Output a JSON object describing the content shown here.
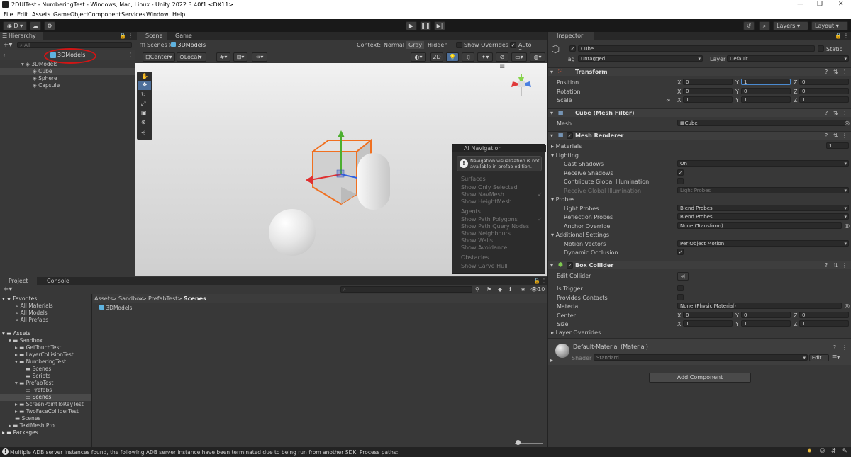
{
  "window": {
    "title": "2DUITest - NumberingTest - Windows, Mac, Linux - Unity 2022.3.40f1 <DX11>",
    "controls": [
      "—",
      "❐",
      "✕"
    ]
  },
  "menu": [
    "File",
    "Edit",
    "Assets",
    "GameObject",
    "Component",
    "Services",
    "Window",
    "Help"
  ],
  "toolbar": {
    "account": "D",
    "layers": "Layers",
    "layout": "Layout"
  },
  "hierarchy": {
    "tab": "Hierarchy",
    "search_placeholder": "All",
    "breadcrumb": "3DModels",
    "root": "3DModels",
    "items": [
      "Cube",
      "Sphere",
      "Capsule"
    ]
  },
  "scene": {
    "tabs": [
      "Scene",
      "Game"
    ],
    "breadcrumb_root": "Scenes",
    "breadcrumb_leaf": "3DModels",
    "context_label": "Context:",
    "context_options": [
      "Normal",
      "Gray",
      "Hidden"
    ],
    "show_overrides": "Show Overrides",
    "auto_save": "Auto Save",
    "pivot": "Center",
    "space": "Local",
    "mode2d": "2D"
  },
  "ai_nav": {
    "title": "AI Navigation",
    "notice": "Navigation visualization is not available in prefab edition.",
    "surfaces": "Surfaces",
    "surface_items": [
      "Show Only Selected",
      "Show NavMesh",
      "Show HeightMesh"
    ],
    "agents": "Agents",
    "agent_items": [
      "Show Path Polygons",
      "Show Path Query Nodes",
      "Show Neighbours",
      "Show Walls",
      "Show Avoidance"
    ],
    "obstacles": "Obstacles",
    "obstacle_items": [
      "Show Carve Hull"
    ]
  },
  "project": {
    "tabs": [
      "Project",
      "Console"
    ],
    "favorites": "Favorites",
    "favorite_items": [
      "All Materials",
      "All Models",
      "All Prefabs"
    ],
    "assets": "Assets",
    "tree": [
      "Sandbox",
      "GetTouchTest",
      "LayerCollisionTest",
      "NumberingTest",
      "Scenes",
      "Scripts",
      "PrefabTest",
      "Prefabs",
      "Scenes",
      "ScreenPointToRayTest",
      "TwoFaceColliderTest",
      "Scenes",
      "TextMesh Pro",
      "Packages"
    ],
    "path": [
      "Assets",
      "Sandbox",
      "PrefabTest",
      "Scenes"
    ],
    "file": "3DModels",
    "count": "10"
  },
  "inspector": {
    "tab": "Inspector",
    "name": "Cube",
    "static": "Static",
    "tag_label": "Tag",
    "tag": "Untagged",
    "layer_label": "Layer",
    "layer": "Default",
    "transform": {
      "title": "Transform",
      "position": "Position",
      "rotation": "Rotation",
      "scale": "Scale",
      "pos": [
        "0",
        "1",
        "0"
      ],
      "rot": [
        "0",
        "0",
        "0"
      ],
      "scl": [
        "1",
        "1",
        "1"
      ]
    },
    "mesh_filter": {
      "title": "Cube (Mesh Filter)",
      "mesh_label": "Mesh",
      "mesh": "Cube"
    },
    "mesh_renderer": {
      "title": "Mesh Renderer",
      "materials": "Materials",
      "materials_count": "1",
      "lighting": "Lighting",
      "cast_shadows": "Cast Shadows",
      "cast_shadows_val": "On",
      "receive_shadows": "Receive Shadows",
      "contribute_gi": "Contribute Global Illumination",
      "receive_gi": "Receive Global Illumination",
      "receive_gi_val": "Light Probes",
      "probes": "Probes",
      "light_probes": "Light Probes",
      "light_probes_val": "Blend Probes",
      "reflection_probes": "Reflection Probes",
      "reflection_probes_val": "Blend Probes",
      "anchor_override": "Anchor Override",
      "anchor_override_val": "None (Transform)",
      "additional": "Additional Settings",
      "motion_vectors": "Motion Vectors",
      "motion_vectors_val": "Per Object Motion",
      "dynamic_occlusion": "Dynamic Occlusion"
    },
    "box_collider": {
      "title": "Box Collider",
      "edit_collider": "Edit Collider",
      "is_trigger": "Is Trigger",
      "provides_contacts": "Provides Contacts",
      "material": "Material",
      "material_val": "None (Physic Material)",
      "center": "Center",
      "size": "Size",
      "center_vals": [
        "0",
        "0",
        "0"
      ],
      "size_vals": [
        "1",
        "1",
        "1"
      ],
      "layer_overrides": "Layer Overrides"
    },
    "material": {
      "name": "Default-Material (Material)",
      "shader_label": "Shader",
      "shader": "Standard",
      "edit": "Edit..."
    },
    "add_component": "Add Component"
  },
  "status": {
    "message": "Multiple ADB server instances found, the following ADB server instance have been terminated due to being run from another SDK. Process paths:"
  }
}
